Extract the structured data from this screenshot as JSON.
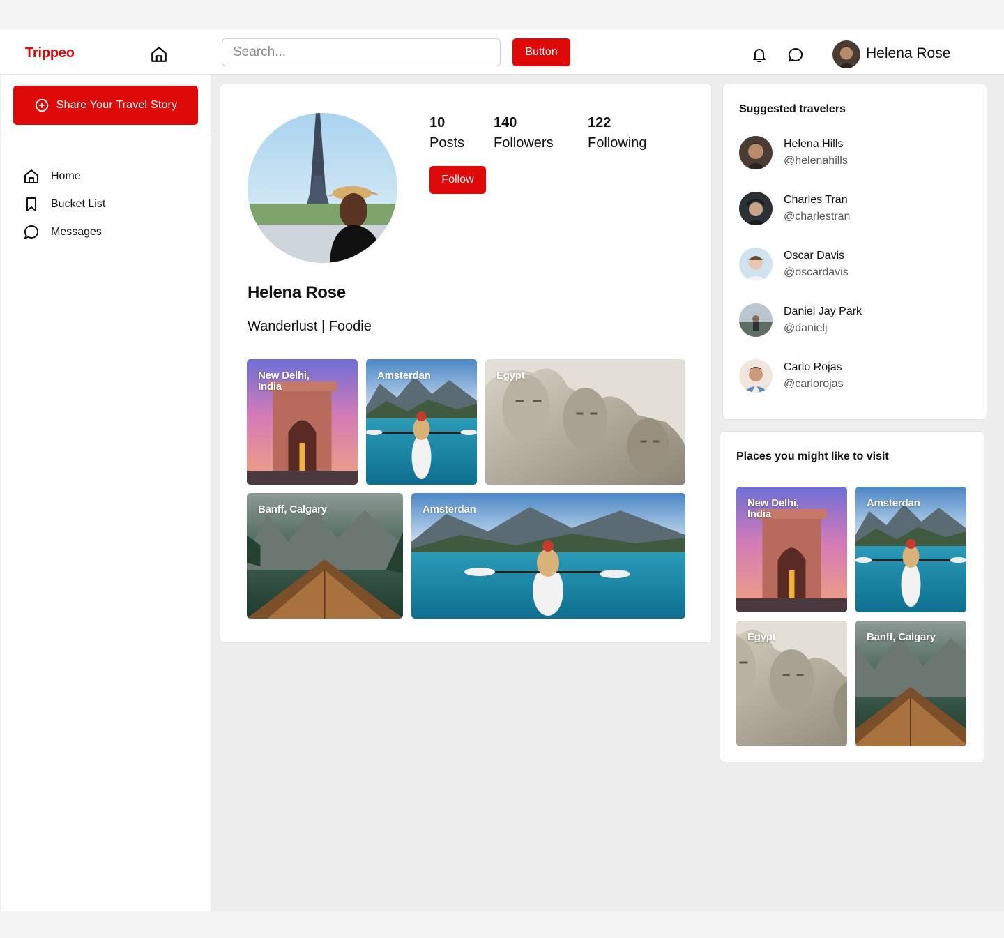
{
  "header": {
    "logo": "Trippeo",
    "search_placeholder": "Search...",
    "button_label": "Button",
    "user_name": "Helena Rose"
  },
  "sidebar": {
    "share_label": "Share Your Travel Story",
    "items": [
      {
        "label": "Home",
        "icon": "home-icon"
      },
      {
        "label": "Bucket List",
        "icon": "bookmark-icon"
      },
      {
        "label": "Messages",
        "icon": "chat-icon"
      }
    ]
  },
  "profile": {
    "name": "Helena Rose",
    "bio": "Wanderlust | Foodie",
    "stats": [
      {
        "value": "10",
        "label": "Posts"
      },
      {
        "value": "140",
        "label": "Followers"
      },
      {
        "value": "122",
        "label": "Following"
      }
    ],
    "follow_label": "Follow",
    "posts": [
      {
        "caption": "New Delhi,\nIndia",
        "scene": "gate"
      },
      {
        "caption": "Amsterdan",
        "scene": "kayak"
      },
      {
        "caption": "Egypt",
        "scene": "rock"
      },
      {
        "caption": "Banff, Calgary",
        "scene": "boat"
      },
      {
        "caption": "Amsterdan",
        "scene": "kayak"
      }
    ]
  },
  "suggested": {
    "title": "Suggested travelers",
    "users": [
      {
        "name": "Helena Hills",
        "handle": "@helenahills"
      },
      {
        "name": "Charles Tran",
        "handle": "@charlestran"
      },
      {
        "name": "Oscar Davis",
        "handle": "@oscardavis"
      },
      {
        "name": "Daniel Jay Park",
        "handle": "@danielj"
      },
      {
        "name": "Carlo Rojas",
        "handle": "@carlorojas"
      }
    ]
  },
  "places": {
    "title": "Places you might like to visit",
    "items": [
      {
        "caption": "New Delhi,\nIndia",
        "scene": "gate"
      },
      {
        "caption": "Amsterdan",
        "scene": "kayak"
      },
      {
        "caption": "Egypt",
        "scene": "rock"
      },
      {
        "caption": "Banff, Calgary",
        "scene": "boat"
      }
    ]
  },
  "colors": {
    "brand": "#de0a0a",
    "page_bg": "#ededed"
  }
}
